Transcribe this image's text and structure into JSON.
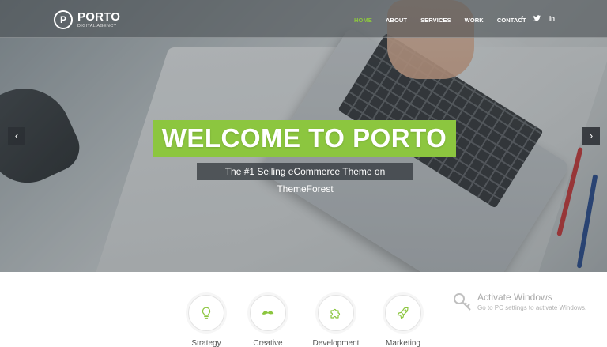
{
  "brand": {
    "name": "PORTO",
    "tagline": "DIGITAL AGENCY",
    "mark": "P",
    "accent_color": "#8cc63f"
  },
  "nav": {
    "items": [
      {
        "label": "HOME",
        "active": true
      },
      {
        "label": "ABOUT",
        "active": false
      },
      {
        "label": "SERVICES",
        "active": false
      },
      {
        "label": "WORK",
        "active": false
      },
      {
        "label": "CONTACT",
        "active": false
      }
    ],
    "social": [
      {
        "icon": "facebook-icon",
        "glyph": "f"
      },
      {
        "icon": "twitter-icon",
        "glyph": "🐦"
      },
      {
        "icon": "linkedin-icon",
        "glyph": "in"
      }
    ]
  },
  "hero": {
    "title": "WELCOME TO PORTO",
    "subtitle": "The #1 Selling eCommerce Theme on ThemeForest",
    "prev_glyph": "‹",
    "next_glyph": "›"
  },
  "services": [
    {
      "label": "Strategy",
      "icon": "lightbulb-icon"
    },
    {
      "label": "Creative",
      "icon": "mustache-icon"
    },
    {
      "label": "Development",
      "icon": "puzzle-icon"
    },
    {
      "label": "Marketing",
      "icon": "rocket-icon"
    }
  ],
  "watermark": {
    "title": "Activate Windows",
    "subtitle": "Go to PC settings to activate Windows."
  }
}
